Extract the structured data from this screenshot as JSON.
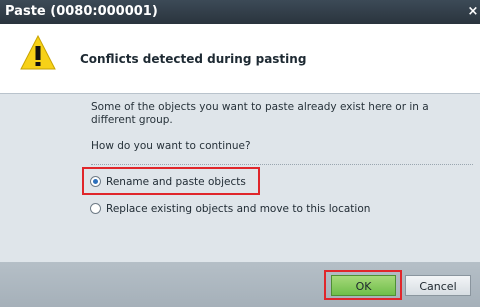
{
  "window": {
    "title": "Paste (0080:000001)",
    "close_glyph": "×"
  },
  "header": {
    "icon": "warning-icon",
    "text": "Conflicts detected during pasting"
  },
  "message": {
    "text": "Some of the objects you want to paste already exist here or in a different group.",
    "question": "How do you want to continue?"
  },
  "options": [
    {
      "label": "Rename and paste objects",
      "selected": true
    },
    {
      "label": "Replace existing objects and move to this location",
      "selected": false
    }
  ],
  "buttons": {
    "ok": "OK",
    "cancel": "Cancel"
  },
  "colors": {
    "title_bar": "#2f3a44",
    "body_background": "#dfe5ea",
    "ok_button": "#7cc653",
    "highlight": "#e0262b",
    "warning_icon": "#f7d117"
  }
}
